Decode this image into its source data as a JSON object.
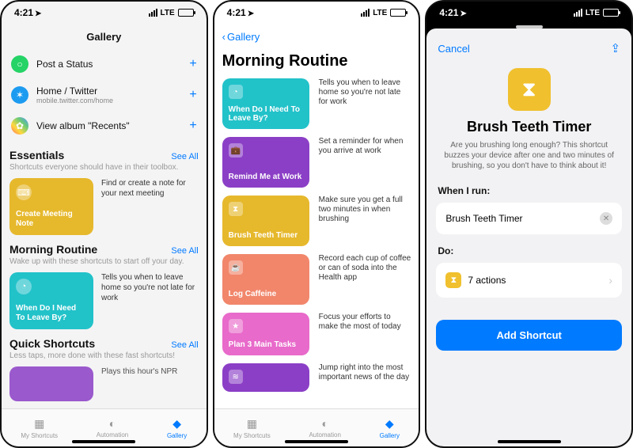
{
  "status": {
    "time": "4:21",
    "carrier": "LTE"
  },
  "tabs": {
    "my_shortcuts": "My Shortcuts",
    "automation": "Automation",
    "gallery": "Gallery"
  },
  "phone1": {
    "title": "Gallery",
    "shortcuts": [
      {
        "label": "Post a Status",
        "sub": "",
        "icon_bg": "#25d366",
        "icon": "○"
      },
      {
        "label": "Home / Twitter",
        "sub": "mobile.twitter.com/home",
        "icon_bg": "#1d9bf0",
        "icon": "✶"
      },
      {
        "label": "View album \"Recents\"",
        "sub": "",
        "icon_bg": "#ff6f61",
        "icon": "✿"
      }
    ],
    "essentials": {
      "title": "Essentials",
      "see_all": "See All",
      "subtitle": "Shortcuts everyone should have in their toolbox.",
      "card": {
        "title": "Create Meeting Note",
        "desc": "Find or create a note for your next meeting",
        "bg": "#e6b82c",
        "icon": "⌨"
      }
    },
    "morning": {
      "title": "Morning Routine",
      "see_all": "See All",
      "subtitle": "Wake up with these shortcuts to start off your day.",
      "card": {
        "title": "When Do I Need To Leave By?",
        "desc": "Tells you when to leave home so you're not late for work",
        "bg": "#22c2c9",
        "icon": "◔"
      }
    },
    "quick": {
      "title": "Quick Shortcuts",
      "see_all": "See All",
      "subtitle": "Less taps, more done with these fast shortcuts!",
      "card_desc": "Plays this hour's NPR"
    }
  },
  "phone2": {
    "back": "Gallery",
    "title": "Morning Routine",
    "items": [
      {
        "title": "When Do I Need To Leave By?",
        "desc": "Tells you when to leave home so you're not late for work",
        "bg": "#22c2c9",
        "icon": "◔"
      },
      {
        "title": "Remind Me at Work",
        "desc": "Set a reminder for when you arrive at work",
        "bg": "#8b3fc6",
        "icon": "💼"
      },
      {
        "title": "Brush Teeth Timer",
        "desc": "Make sure you get a full two minutes in when brushing",
        "bg": "#e6b82c",
        "icon": "⧗"
      },
      {
        "title": "Log Caffeine",
        "desc": "Record each cup of coffee or can of soda into the Health app",
        "bg": "#f1866b",
        "icon": "☕"
      },
      {
        "title": "Plan 3 Main Tasks",
        "desc": "Focus your efforts to make the most of today",
        "bg": "#e86aca",
        "icon": "★"
      },
      {
        "title": "",
        "desc": "Jump right into the most important news of the day",
        "bg": "#8b3fc6",
        "icon": "≋"
      }
    ]
  },
  "phone3": {
    "cancel": "Cancel",
    "title": "Brush Teeth Timer",
    "subtitle": "Are you brushing long enough? This shortcut buzzes your device after one and two minutes of brushing, so you don't have to think about it!",
    "when_label": "When I run:",
    "when_value": "Brush Teeth Timer",
    "do_label": "Do:",
    "do_value": "7 actions",
    "add": "Add Shortcut"
  }
}
